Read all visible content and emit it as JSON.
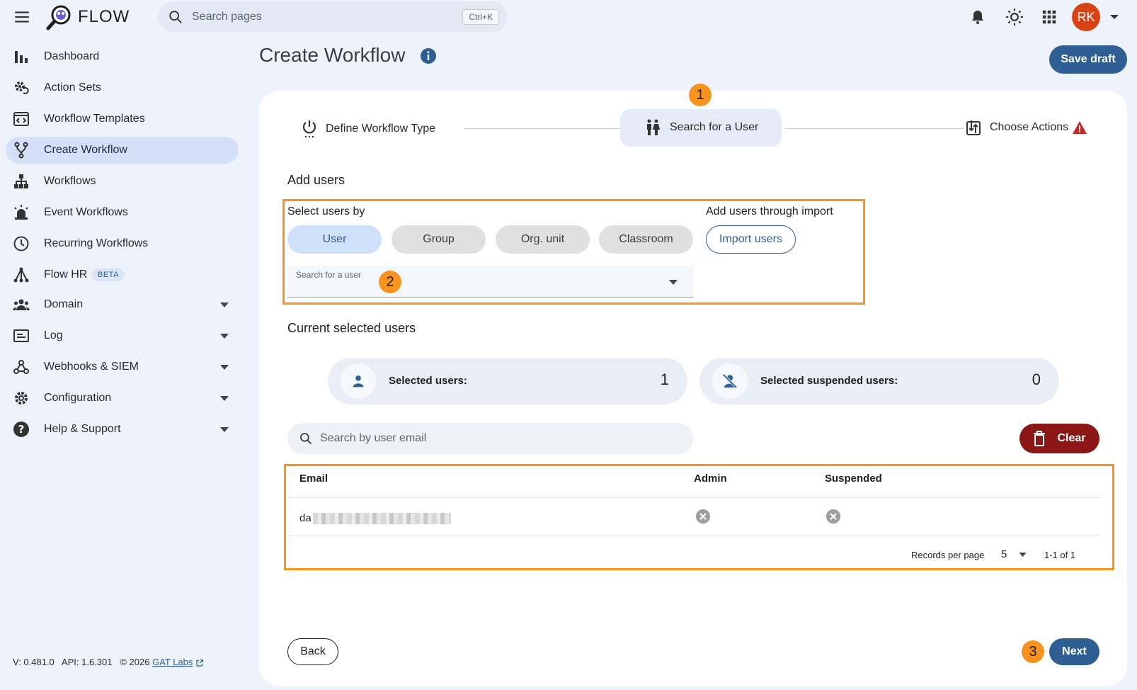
{
  "app": {
    "name": "FLOW"
  },
  "topbar": {
    "search_placeholder": "Search pages",
    "search_shortcut": "Ctrl+K",
    "user_initials": "RK"
  },
  "sidebar": {
    "items": [
      {
        "label": "Dashboard",
        "icon": "bar-chart-icon"
      },
      {
        "label": "Action Sets",
        "icon": "gear-refresh-icon"
      },
      {
        "label": "Workflow Templates",
        "icon": "template-icon"
      },
      {
        "label": "Create Workflow",
        "icon": "fork-icon",
        "active": true
      },
      {
        "label": "Workflows",
        "icon": "hierarchy-icon"
      },
      {
        "label": "Event Workflows",
        "icon": "alarm-icon"
      },
      {
        "label": "Recurring Workflows",
        "icon": "clock-icon"
      },
      {
        "label": "Flow HR",
        "icon": "network-icon",
        "badge": "BETA"
      },
      {
        "label": "Domain",
        "icon": "people-icon",
        "expandable": true
      },
      {
        "label": "Log",
        "icon": "log-icon",
        "expandable": true
      },
      {
        "label": "Webhooks & SIEM",
        "icon": "webhook-icon",
        "expandable": true
      },
      {
        "label": "Configuration",
        "icon": "gear-icon",
        "expandable": true
      },
      {
        "label": "Help & Support",
        "icon": "help-icon",
        "expandable": true
      }
    ],
    "footer": {
      "version": "V: 0.481.0",
      "api": "API: 1.6.301",
      "copyright": "© 2026",
      "company_link": "GAT Labs"
    }
  },
  "main": {
    "title": "Create Workflow",
    "save_draft_label": "Save draft",
    "steps": [
      {
        "label": "Define Workflow Type",
        "icon": "power-icon"
      },
      {
        "label": "Search for a User",
        "icon": "people-pair-icon",
        "active": true
      },
      {
        "label": "Choose Actions",
        "icon": "swap-icon",
        "warning": true
      }
    ],
    "callouts": [
      "1",
      "2",
      "3"
    ],
    "add_users": {
      "heading": "Add users",
      "select_by_label": "Select users by",
      "options": [
        "User",
        "Group",
        "Org. unit",
        "Classroom"
      ],
      "selected_option": "User",
      "import_label": "Add users through import",
      "import_button": "Import users",
      "search_user_label": "Search for a user"
    },
    "current": {
      "heading": "Current selected users",
      "selected_label": "Selected users:",
      "selected_count": "1",
      "suspended_label": "Selected suspended users:",
      "suspended_count": "0"
    },
    "email_search_placeholder": "Search by user email",
    "clear_label": "Clear",
    "table": {
      "columns": [
        "Email",
        "Admin",
        "Suspended"
      ],
      "rows": [
        {
          "email_prefix": "da",
          "admin": false,
          "suspended": false
        }
      ],
      "records_per_page_label": "Records per page",
      "records_per_page": "5",
      "range": "1-1 of 1"
    },
    "back_label": "Back",
    "next_label": "Next"
  },
  "colors": {
    "primary": "#2f5e94",
    "danger": "#8b1616",
    "callout": "#f7931e",
    "active_nav": "#d3e0f7"
  }
}
